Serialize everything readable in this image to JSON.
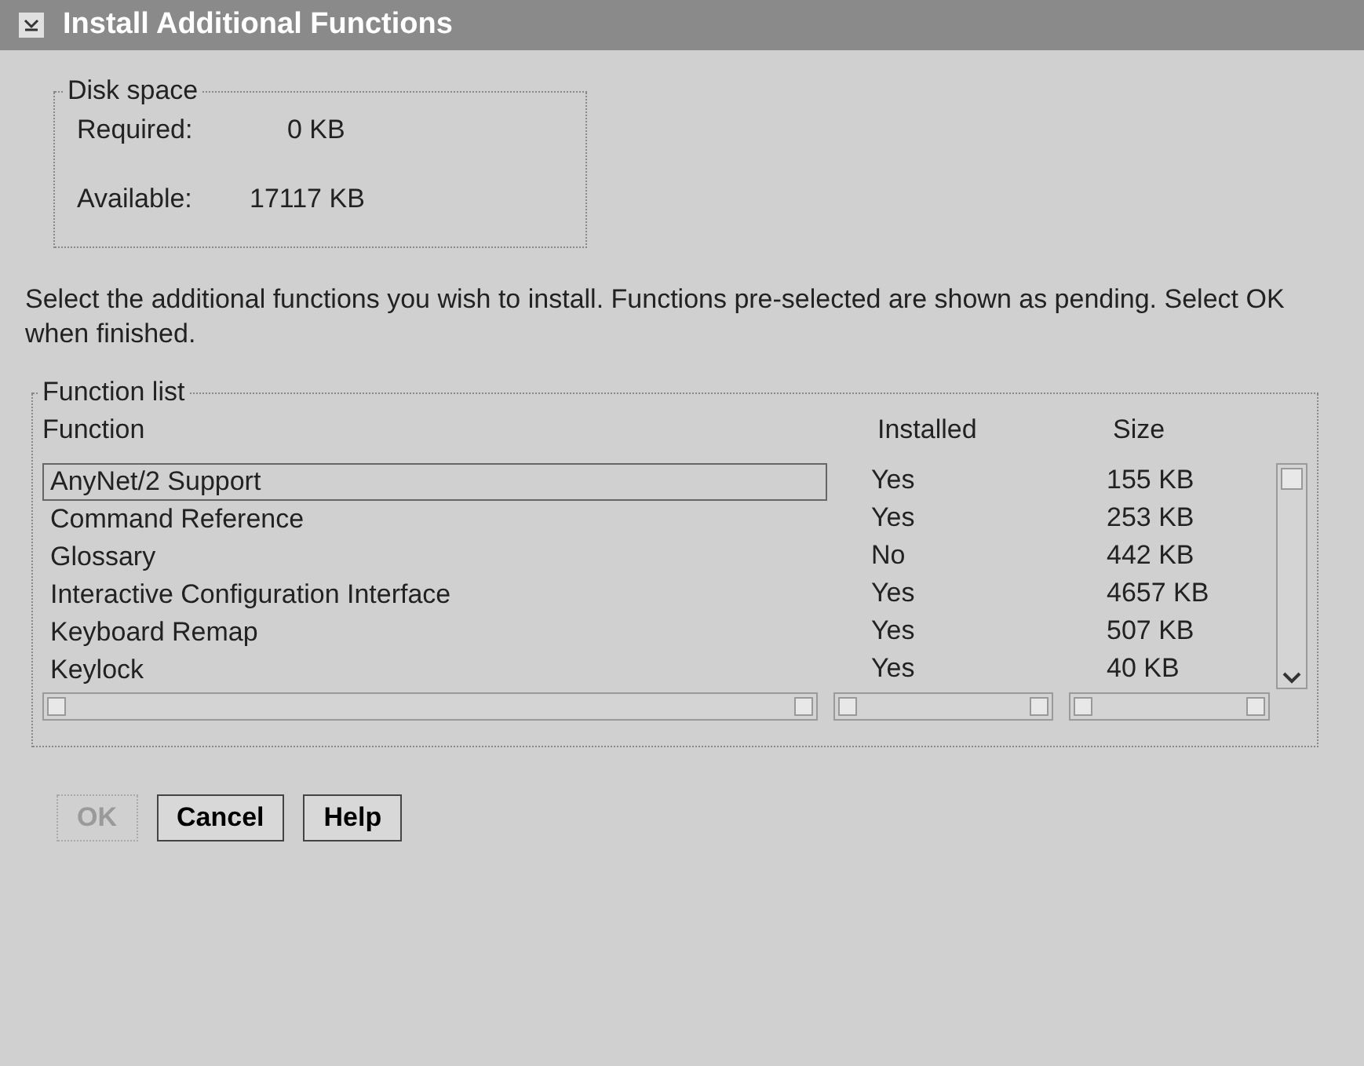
{
  "window": {
    "title": "Install Additional Functions"
  },
  "disk_space": {
    "title": "Disk space",
    "rows": [
      {
        "label": "Required:",
        "value": "0 KB"
      },
      {
        "label": "Available:",
        "value": "17117 KB"
      }
    ]
  },
  "instructions": "Select the additional functions you wish to install.  Functions pre-selected are shown as pending.  Select OK when finished.",
  "function_list": {
    "title": "Function list",
    "columns": [
      "Function",
      "Installed",
      "Size"
    ],
    "rows": [
      {
        "function": "AnyNet/2 Support",
        "installed": "Yes",
        "size": "155 KB",
        "focused": true
      },
      {
        "function": "Command Reference",
        "installed": "Yes",
        "size": "253 KB",
        "focused": false
      },
      {
        "function": "Glossary",
        "installed": "No",
        "size": "442 KB",
        "focused": false
      },
      {
        "function": "Interactive Configuration Interface",
        "installed": "Yes",
        "size": "4657 KB",
        "focused": false
      },
      {
        "function": "Keyboard Remap",
        "installed": "Yes",
        "size": "507 KB",
        "focused": false
      },
      {
        "function": "Keylock",
        "installed": "Yes",
        "size": "40 KB",
        "focused": false
      }
    ]
  },
  "buttons": [
    {
      "label": "OK",
      "disabled": true
    },
    {
      "label": "Cancel",
      "disabled": false
    },
    {
      "label": "Help",
      "disabled": false
    }
  ]
}
